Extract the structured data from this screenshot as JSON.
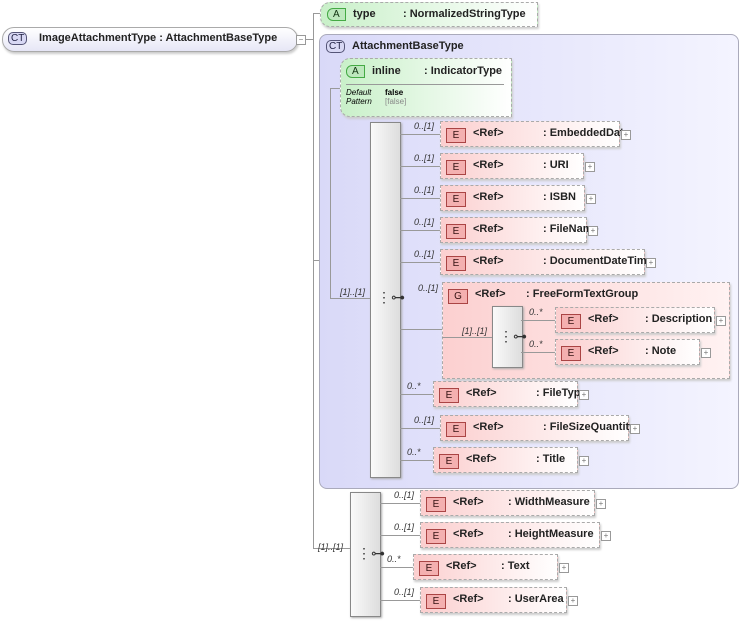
{
  "root": {
    "badge": "CT",
    "name": "ImageAttachmentType : AttachmentBaseType"
  },
  "type_attr": {
    "badge": "A",
    "name": "type",
    "type": ": NormalizedStringType"
  },
  "base": {
    "badge": "CT",
    "name": "AttachmentBaseType",
    "inline_attr": {
      "badge": "A",
      "name": "inline",
      "type": ": IndicatorType",
      "default_label": "Default",
      "default_value": "false",
      "pattern_label": "Pattern",
      "pattern_value": "[false]"
    },
    "sequence_mult": "[1]..[1]",
    "elements": [
      {
        "mult": "0..[1]",
        "badge": "E",
        "ref": "<Ref>",
        "type": ": EmbeddedData"
      },
      {
        "mult": "0..[1]",
        "badge": "E",
        "ref": "<Ref>",
        "type": ": URI"
      },
      {
        "mult": "0..[1]",
        "badge": "E",
        "ref": "<Ref>",
        "type": ": ISBN"
      },
      {
        "mult": "0..[1]",
        "badge": "E",
        "ref": "<Ref>",
        "type": ": FileName"
      },
      {
        "mult": "0..[1]",
        "badge": "E",
        "ref": "<Ref>",
        "type": ": DocumentDateTime"
      },
      {
        "mult": "0..*",
        "badge": "E",
        "ref": "<Ref>",
        "type": ": FileType"
      },
      {
        "mult": "0..[1]",
        "badge": "E",
        "ref": "<Ref>",
        "type": ": FileSizeQuantity"
      },
      {
        "mult": "0..*",
        "badge": "E",
        "ref": "<Ref>",
        "type": ": Title"
      }
    ],
    "group": {
      "mult": "0..[1]",
      "badge": "G",
      "ref": "<Ref>",
      "type": ": FreeFormTextGroup",
      "sequence_mult": "[1]..[1]",
      "elements": [
        {
          "mult": "0..*",
          "badge": "E",
          "ref": "<Ref>",
          "type": ": Description"
        },
        {
          "mult": "0..*",
          "badge": "E",
          "ref": "<Ref>",
          "type": ": Note"
        }
      ]
    }
  },
  "ext": {
    "sequence_mult": "[1]..[1]",
    "elements": [
      {
        "mult": "0..[1]",
        "badge": "E",
        "ref": "<Ref>",
        "type": ": WidthMeasure"
      },
      {
        "mult": "0..[1]",
        "badge": "E",
        "ref": "<Ref>",
        "type": ": HeightMeasure"
      },
      {
        "mult": "0..*",
        "badge": "E",
        "ref": "<Ref>",
        "type": ": Text"
      },
      {
        "mult": "0..[1]",
        "badge": "E",
        "ref": "<Ref>",
        "type": ": UserArea"
      }
    ]
  }
}
